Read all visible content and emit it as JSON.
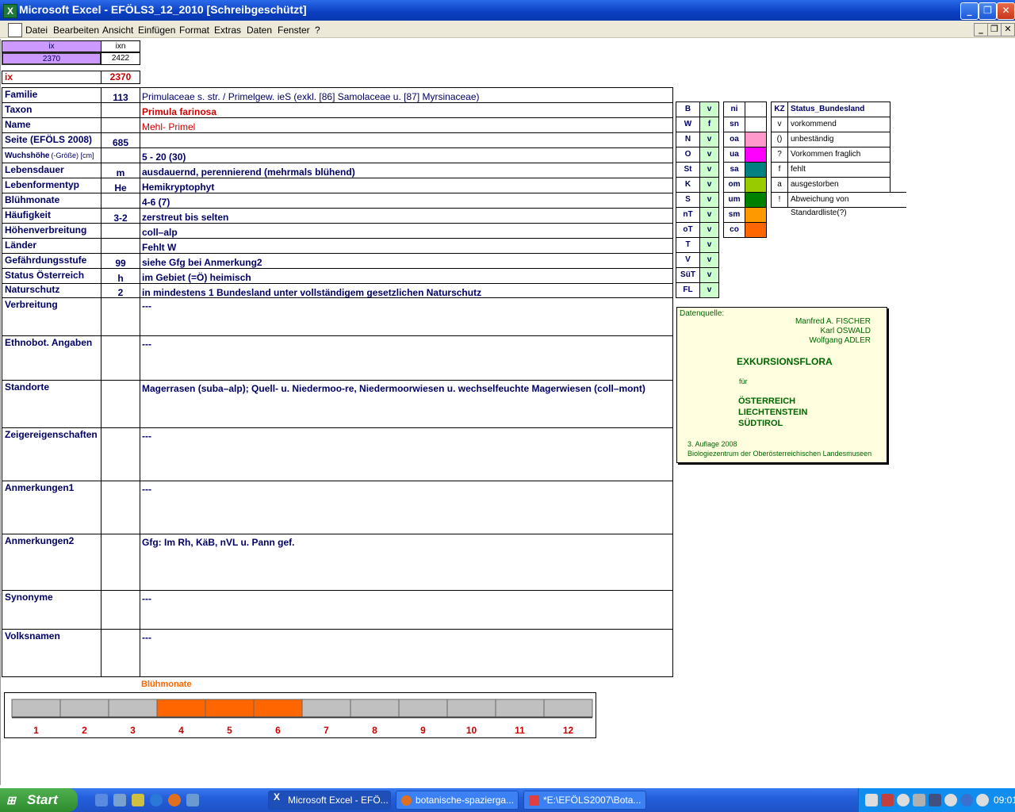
{
  "window": {
    "title": "Microsoft Excel - EFÖLS3_12_2010  [Schreibgeschützt]"
  },
  "menu": [
    "Datei",
    "Bearbeiten",
    "Ansicht",
    "Einfügen",
    "Format",
    "Extras",
    "Daten",
    "Fenster",
    "?"
  ],
  "header": {
    "ix_col": "ix",
    "ixn_col": "ixn",
    "ix_value": "2370",
    "ixn_value": "2422",
    "ix_label": "ix",
    "ix_red_value": "2370"
  },
  "rows": [
    {
      "label": "Familie",
      "code": "113",
      "value": "Primulaceae s. str.  /  Primelgew. ieS (exkl. [86] Samolaceae u. [87] Myrsinaceae)"
    },
    {
      "label": "Taxon",
      "code": "",
      "value": "Primula farinosa"
    },
    {
      "label": "Name",
      "code": "",
      "value": "Mehl- Primel"
    },
    {
      "label": "Seite (EFÖLS 2008)",
      "code": "685",
      "value": ""
    },
    {
      "label": "Wuchshöhe",
      "label_extra": "(-Größe) [cm]",
      "code": "",
      "value": " 5 - 20 (30)"
    },
    {
      "label": "Lebensdauer",
      "code": "m",
      "value": "ausdauernd, perennierend (mehrmals blühend)"
    },
    {
      "label": "Lebenformentyp",
      "code": "He",
      "value": "Hemikryptophyt"
    },
    {
      "label": "Blühmonate",
      "code": "",
      "value": " 4-6 (7)"
    },
    {
      "label": "Häufigkeit",
      "code": "3-2",
      "value": "zerstreut bis selten"
    },
    {
      "label": "Höhenverbreitung",
      "code": "",
      "value": "coll–alp"
    },
    {
      "label": "Länder",
      "code": "",
      "value": "Fehlt W"
    },
    {
      "label": "Gefährdungsstufe",
      "code": "99",
      "value": "siehe Gfg bei Anmerkung2"
    },
    {
      "label": "Status Österreich",
      "code": "h",
      "value": "im Gebiet (=Ö) heimisch"
    },
    {
      "label": "Naturschutz",
      "code": "2",
      "value": "in mindestens 1 Bundesland unter vollständigem gesetzlichen Naturschutz"
    },
    {
      "label": "Verbreitung",
      "code": "",
      "value": "---"
    },
    {
      "label": "Ethnobot. Angaben",
      "code": "",
      "value": "---"
    },
    {
      "label": "Standorte",
      "code": "",
      "value": "Magerrasen (suba–alp); Quell- u. Niedermoo-re, Niedermoorwiesen u. wechselfeuchte Magerwiesen (coll–mont)"
    },
    {
      "label": "Zeigereigenschaften",
      "code": "",
      "value": "---"
    },
    {
      "label": "Anmerkungen1",
      "code": "",
      "value": "---"
    },
    {
      "label": "Anmerkungen2",
      "code": "",
      "value": "Gfg: Im Rh, KäB, nVL u. Pann gef."
    },
    {
      "label": "Synonyme",
      "code": "",
      "value": "---"
    },
    {
      "label": "Volksnamen",
      "code": "",
      "value": "---"
    }
  ],
  "states": [
    {
      "code": "B",
      "val": "v"
    },
    {
      "code": "W",
      "val": "f"
    },
    {
      "code": "N",
      "val": "v"
    },
    {
      "code": "O",
      "val": "v"
    },
    {
      "code": "St",
      "val": "v"
    },
    {
      "code": "K",
      "val": "v"
    },
    {
      "code": "S",
      "val": "v"
    },
    {
      "code": "nT",
      "val": "v"
    },
    {
      "code": "oT",
      "val": "v"
    },
    {
      "code": "T",
      "val": "v"
    },
    {
      "code": "V",
      "val": "v"
    },
    {
      "code": "SüT",
      "val": "v"
    },
    {
      "code": "FL",
      "val": "v"
    }
  ],
  "regions": [
    {
      "code": "ni",
      "color": ""
    },
    {
      "code": "sn",
      "color": ""
    },
    {
      "code": "oa",
      "color": "#ff99cc"
    },
    {
      "code": "ua",
      "color": "#ff00ff"
    },
    {
      "code": "sa",
      "color": "#008080"
    },
    {
      "code": "om",
      "color": "#99cc00"
    },
    {
      "code": "um",
      "color": "#008000"
    },
    {
      "code": "sm",
      "color": "#ff9900"
    },
    {
      "code": "co",
      "color": "#ff6600"
    }
  ],
  "status_legend": {
    "kz_header": "KZ",
    "title": "Status_Bundesland",
    "items": [
      {
        "kz": "v",
        "text": "vorkommend"
      },
      {
        "kz": "()",
        "text": "unbeständig"
      },
      {
        "kz": "?",
        "text": "Vorkommen fraglich"
      },
      {
        "kz": "f",
        "text": "fehlt"
      },
      {
        "kz": "a",
        "text": "ausgestorben"
      },
      {
        "kz": "!",
        "text": "Abweichung von Standardliste(?)"
      }
    ]
  },
  "source": {
    "label": "Datenquelle:",
    "authors": [
      "Manfred A. FISCHER",
      "Karl OSWALD",
      "Wolfgang ADLER"
    ],
    "book": "EXKURSIONSFLORA",
    "fuer": "für",
    "countries": [
      "ÖSTERREICH",
      "LIECHTENSTEIN",
      "SÜDTIROL"
    ],
    "edition": "3. Auflage 2008",
    "publisher": "Biologiezentrum der Oberösterreichischen Landesmuseen"
  },
  "chart_data": {
    "type": "bar",
    "title": "Blühmonate",
    "categories": [
      "1",
      "2",
      "3",
      "4",
      "5",
      "6",
      "7",
      "8",
      "9",
      "10",
      "11",
      "12"
    ],
    "flowering": [
      false,
      false,
      false,
      true,
      true,
      true,
      false,
      false,
      false,
      false,
      false,
      false
    ],
    "colors": {
      "on": "#ff6600",
      "off": "#c0c0c0"
    }
  },
  "taskbar": {
    "start": "Start",
    "tasks": [
      "Microsoft Excel - EFÖ...",
      "botanische-spazierga...",
      "*E:\\EFÖLS2007\\Bota..."
    ],
    "clock": "09:01"
  }
}
